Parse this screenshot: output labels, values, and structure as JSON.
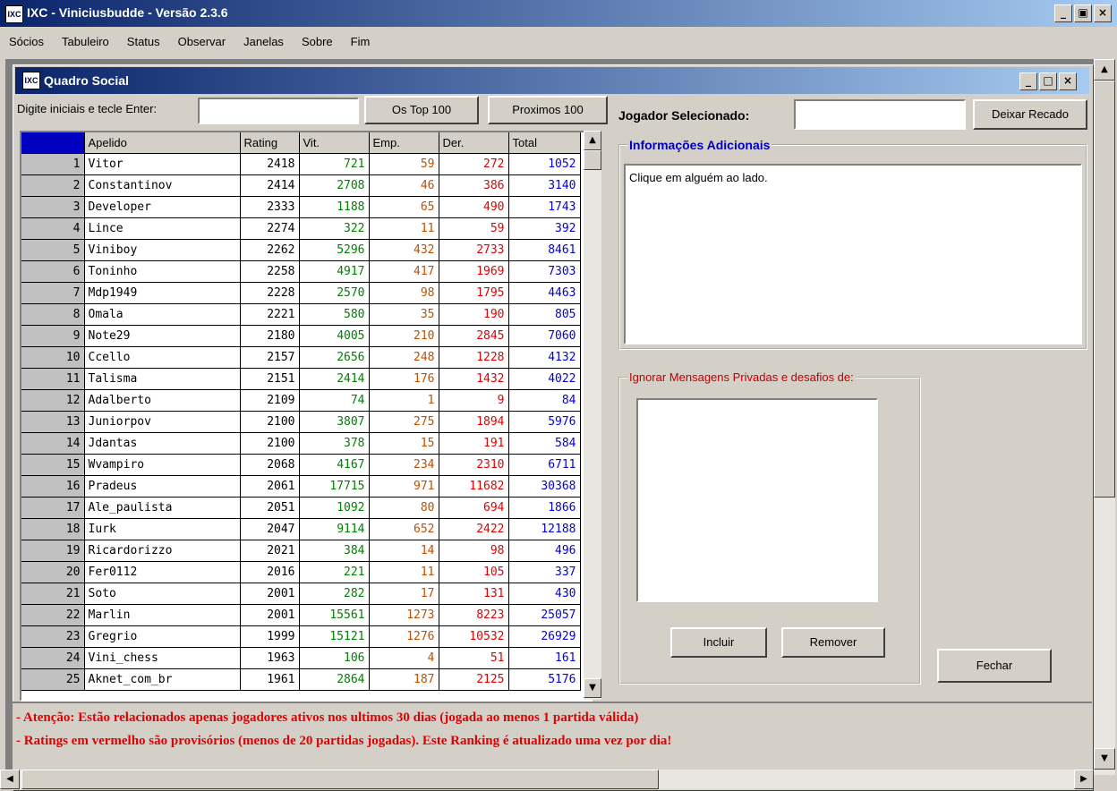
{
  "window": {
    "title": "IXC - Viniciusbudde - Versão 2.3.6",
    "icon_text": "IXC",
    "minimize": "_",
    "maximize": "▣",
    "close": "×"
  },
  "menu": [
    "Sócios",
    "Tabuleiro",
    "Status",
    "Observar",
    "Janelas",
    "Sobre",
    "Fim"
  ],
  "child_window": {
    "title": "Quadro Social",
    "minimize": "_",
    "maximize": "□",
    "close": "×"
  },
  "search": {
    "label": "Digite iniciais e tecle Enter:",
    "value": ""
  },
  "buttons": {
    "top100": "Os Top 100",
    "next100": "Proximos 100",
    "leave_message": "Deixar Recado",
    "include": "Incluir",
    "remove": "Remover",
    "close": "Fechar"
  },
  "selected_player": {
    "label": "Jogador Selecionado:",
    "value": ""
  },
  "additional_info": {
    "title": "Informações Adicionais",
    "text": "Clique em alguém ao lado."
  },
  "ignore": {
    "title": "Ignorar Mensagens Privadas e desafios de:"
  },
  "table": {
    "columns": [
      "Apelido",
      "Rating",
      "Vit.",
      "Emp.",
      "Der.",
      "Total"
    ],
    "rows": [
      [
        "1",
        "Vitor",
        "2418",
        "721",
        "59",
        "272",
        "1052"
      ],
      [
        "2",
        "Constantinov",
        "2414",
        "2708",
        "46",
        "386",
        "3140"
      ],
      [
        "3",
        "Developer",
        "2333",
        "1188",
        "65",
        "490",
        "1743"
      ],
      [
        "4",
        "Lince",
        "2274",
        "322",
        "11",
        "59",
        "392"
      ],
      [
        "5",
        "Viniboy",
        "2262",
        "5296",
        "432",
        "2733",
        "8461"
      ],
      [
        "6",
        "Toninho",
        "2258",
        "4917",
        "417",
        "1969",
        "7303"
      ],
      [
        "7",
        "Mdp1949",
        "2228",
        "2570",
        "98",
        "1795",
        "4463"
      ],
      [
        "8",
        "Omala",
        "2221",
        "580",
        "35",
        "190",
        "805"
      ],
      [
        "9",
        "Note29",
        "2180",
        "4005",
        "210",
        "2845",
        "7060"
      ],
      [
        "10",
        "Ccello",
        "2157",
        "2656",
        "248",
        "1228",
        "4132"
      ],
      [
        "11",
        "Talisma",
        "2151",
        "2414",
        "176",
        "1432",
        "4022"
      ],
      [
        "12",
        "Adalberto",
        "2109",
        "74",
        "1",
        "9",
        "84"
      ],
      [
        "13",
        "Juniorpov",
        "2100",
        "3807",
        "275",
        "1894",
        "5976"
      ],
      [
        "14",
        "Jdantas",
        "2100",
        "378",
        "15",
        "191",
        "584"
      ],
      [
        "15",
        "Wvampiro",
        "2068",
        "4167",
        "234",
        "2310",
        "6711"
      ],
      [
        "16",
        "Pradeus",
        "2061",
        "17715",
        "971",
        "11682",
        "30368"
      ],
      [
        "17",
        "Ale_paulista",
        "2051",
        "1092",
        "80",
        "694",
        "1866"
      ],
      [
        "18",
        "Iurk",
        "2047",
        "9114",
        "652",
        "2422",
        "12188"
      ],
      [
        "19",
        "Ricardorizzo",
        "2021",
        "384",
        "14",
        "98",
        "496"
      ],
      [
        "20",
        "Fer0112",
        "2016",
        "221",
        "11",
        "105",
        "337"
      ],
      [
        "21",
        "Soto",
        "2001",
        "282",
        "17",
        "131",
        "430"
      ],
      [
        "22",
        "Marlin",
        "2001",
        "15561",
        "1273",
        "8223",
        "25057"
      ],
      [
        "23",
        "Gregrio",
        "1999",
        "15121",
        "1276",
        "10532",
        "26929"
      ],
      [
        "24",
        "Vini_chess",
        "1963",
        "106",
        "4",
        "51",
        "161"
      ],
      [
        "25",
        "Aknet_com_br",
        "1961",
        "2864",
        "187",
        "2125",
        "5176"
      ]
    ]
  },
  "footer": {
    "line1": "- Atenção: Estão relacionados apenas jogadores ativos nos ultimos 30 dias (jogada ao menos 1 partida válida)",
    "line2": "- Ratings em vermelho são provisórios (menos de 20 partidas jogadas). Este Ranking é atualizado uma vez por dia!"
  },
  "colors": {
    "titlebar_start": "#0a246a",
    "titlebar_end": "#a6caf0",
    "win": "#008000",
    "draw": "#c05000",
    "loss": "#e00000",
    "total": "#0000e0"
  }
}
